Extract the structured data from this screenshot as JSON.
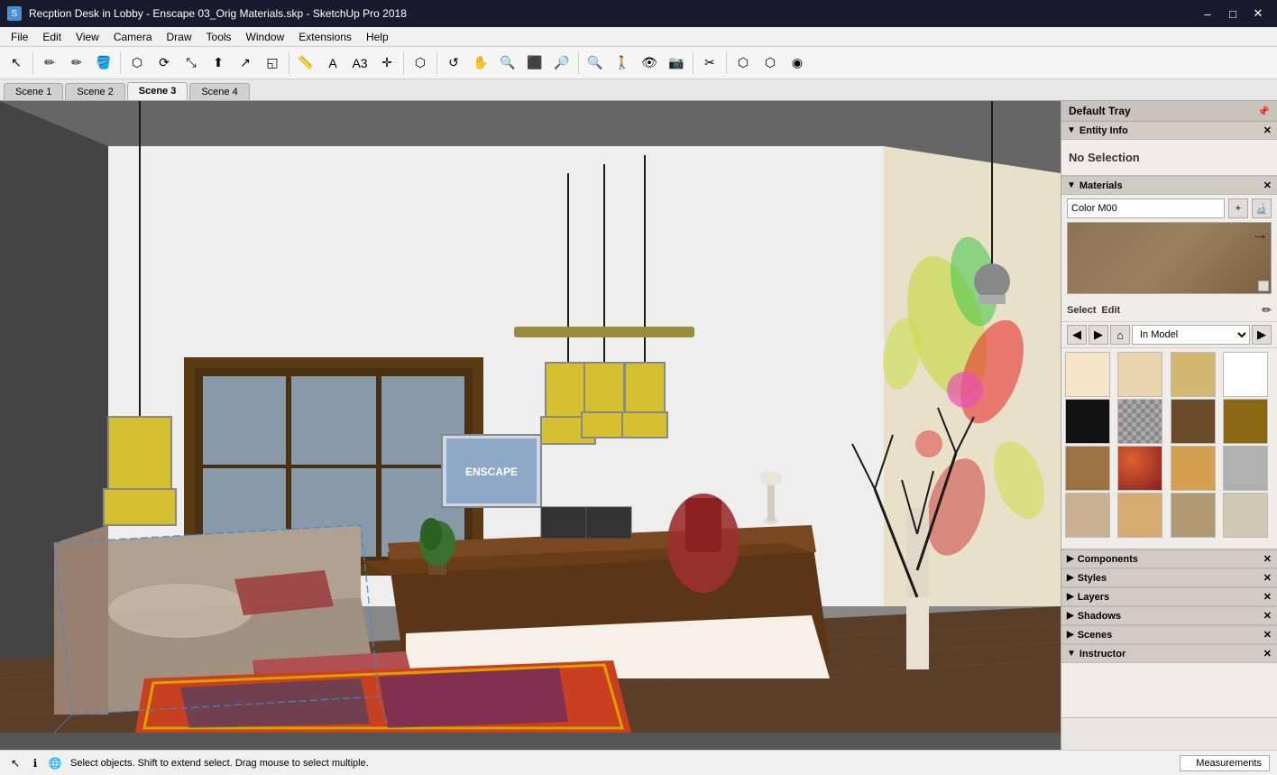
{
  "titlebar": {
    "title": "Recption Desk in Lobby - Enscape 03_Orig Materials.skp - SketchUp Pro 2018",
    "icon": "S",
    "minimize": "–",
    "maximize": "□",
    "close": "✕"
  },
  "menubar": {
    "items": [
      "File",
      "Edit",
      "View",
      "Camera",
      "Draw",
      "Tools",
      "Window",
      "Extensions",
      "Help"
    ]
  },
  "toolbar": {
    "tools": [
      {
        "name": "select",
        "icon": "↖",
        "label": "Select"
      },
      {
        "name": "erase",
        "icon": "✏",
        "label": "Erase"
      },
      {
        "name": "pencil",
        "icon": "✏",
        "label": "Pencil"
      },
      {
        "name": "paint",
        "icon": "🪣",
        "label": "Paint"
      },
      {
        "name": "move",
        "icon": "✛",
        "label": "Move"
      },
      {
        "name": "rotate",
        "icon": "↻",
        "label": "Rotate"
      },
      {
        "name": "scale",
        "icon": "⤡",
        "label": "Scale"
      },
      {
        "name": "push-pull",
        "icon": "⬆",
        "label": "Push/Pull"
      },
      {
        "name": "follow-me",
        "icon": "↗",
        "label": "Follow Me"
      },
      {
        "name": "offset",
        "icon": "◱",
        "label": "Offset"
      },
      {
        "name": "tape",
        "icon": "📏",
        "label": "Tape"
      },
      {
        "name": "text",
        "icon": "A",
        "label": "Text"
      },
      {
        "name": "3d-text",
        "icon": "A³",
        "label": "3D Text"
      },
      {
        "name": "axes",
        "icon": "✛",
        "label": "Axes"
      },
      {
        "name": "component",
        "icon": "⬡",
        "label": "Component"
      },
      {
        "name": "orbit",
        "icon": "↻",
        "label": "Orbit"
      },
      {
        "name": "pan",
        "icon": "✋",
        "label": "Pan"
      },
      {
        "name": "zoom",
        "icon": "🔍",
        "label": "Zoom"
      },
      {
        "name": "zoom-extents",
        "icon": "⊞",
        "label": "Zoom Extents"
      },
      {
        "name": "zoom-window",
        "icon": "🔍",
        "label": "Zoom Window"
      },
      {
        "name": "zoom-prev",
        "icon": "🔎",
        "label": "Zoom Previous"
      },
      {
        "name": "walk",
        "icon": "🚶",
        "label": "Walk"
      },
      {
        "name": "look",
        "icon": "👁",
        "label": "Look Around"
      },
      {
        "name": "position-camera",
        "icon": "📷",
        "label": "Position Camera"
      },
      {
        "name": "section-plane",
        "icon": "✂",
        "label": "Section Plane"
      },
      {
        "name": "enscape1",
        "icon": "◈",
        "label": "Enscape"
      },
      {
        "name": "enscape2",
        "icon": "◉",
        "label": "Enscape Render"
      },
      {
        "name": "enscape3",
        "icon": "◐",
        "label": "Enscape Material"
      }
    ]
  },
  "scenes": {
    "tabs": [
      "Scene 1",
      "Scene 2",
      "Scene 3",
      "Scene 4"
    ],
    "active": "Scene 3"
  },
  "right_panel": {
    "tray_title": "Default Tray",
    "entity_info": {
      "header": "Entity Info",
      "status": "No Selection"
    },
    "materials": {
      "header": "Materials",
      "color_name": "Color M00",
      "select_label": "Select",
      "edit_label": "Edit",
      "model_dropdown": "In Model",
      "thumbnails": [
        {
          "color": "#f5e6c8",
          "type": "plain"
        },
        {
          "color": "#e8d5b0",
          "type": "plain"
        },
        {
          "color": "#d4b870",
          "type": "plain"
        },
        {
          "color": "#ffffff",
          "type": "plain"
        },
        {
          "color": "#111111",
          "type": "plain"
        },
        {
          "color": "#888888",
          "type": "texture"
        },
        {
          "color": "#6b4c2a",
          "type": "plain"
        },
        {
          "color": "#8b6914",
          "type": "plain"
        },
        {
          "color": "#9b7240",
          "type": "plain"
        },
        {
          "color": "#cc4422",
          "type": "texture"
        },
        {
          "color": "#d4a050",
          "type": "plain"
        },
        {
          "color": "#b0b0b0",
          "type": "plain"
        },
        {
          "color": "#c8b090",
          "type": "plain"
        },
        {
          "color": "#d4aa70",
          "type": "plain"
        },
        {
          "color": "#b09870",
          "type": "plain"
        },
        {
          "color": "#d0c8b0",
          "type": "plain"
        }
      ]
    },
    "components": {
      "header": "Components"
    },
    "styles": {
      "header": "Styles"
    },
    "layers": {
      "header": "Layers"
    },
    "shadows": {
      "header": "Shadows"
    },
    "scenes_panel": {
      "header": "Scenes"
    },
    "instructor": {
      "header": "Instructor"
    }
  },
  "statusbar": {
    "message": "Select objects. Shift to extend select. Drag mouse to select multiple.",
    "measurements_label": "Measurements"
  }
}
